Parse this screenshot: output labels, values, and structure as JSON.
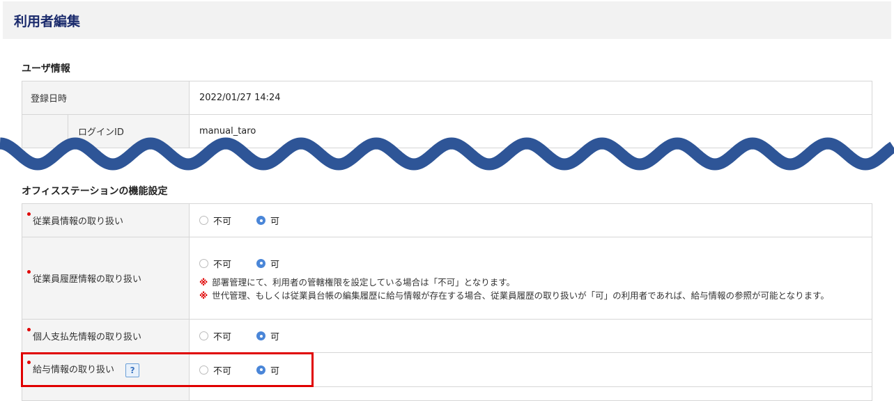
{
  "page": {
    "title": "利用者編集"
  },
  "user_info": {
    "heading": "ユーザ情報",
    "rows": [
      {
        "label": "登録日時",
        "value": "2022/01/27 14:24"
      },
      {
        "label": "ログインID",
        "value": "manual_taro"
      }
    ]
  },
  "office": {
    "heading": "オフィスステーションの機能設定",
    "options": {
      "no": "不可",
      "yes": "可"
    },
    "rows": [
      {
        "label": "従業員情報の取り扱い",
        "selected": "可"
      },
      {
        "label": "従業員履歴情報の取り扱い",
        "selected": "可",
        "notes": [
          "部署管理にて、利用者の管轄権限を設定している場合は「不可」となります。",
          "世代管理、もしくは従業員台帳の編集履歴に給与情報が存在する場合、従業員履歴の取り扱いが「可」の利用者であれば、給与情報の参照が可能となります。"
        ],
        "note_mark": "※"
      },
      {
        "label": "個人支払先情報の取り扱い",
        "selected": "可"
      },
      {
        "label": "給与情報の取り扱い",
        "selected": "可",
        "help": "?"
      }
    ]
  },
  "colors": {
    "accent": "#4a86d8",
    "required": "#e00000",
    "wave": "#2e5597",
    "highlight": "#e00000"
  }
}
